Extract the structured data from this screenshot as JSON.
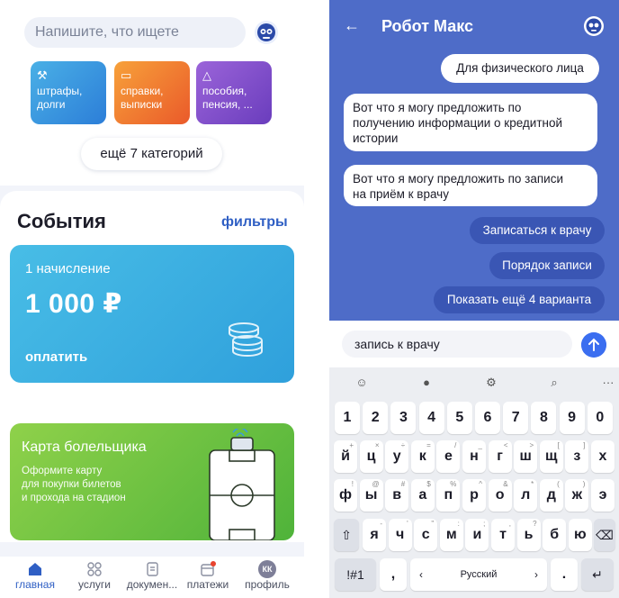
{
  "left": {
    "search_placeholder": "Напишите, что ищете",
    "categories": [
      {
        "label": "штрафы,\nдолги",
        "icon": "hammer-icon"
      },
      {
        "label": "справки,\nвыписки",
        "icon": "folder-icon"
      },
      {
        "label": "пособия,\nпенсия, ...",
        "icon": "piggy-icon"
      }
    ],
    "more_categories": "ещё 7 категорий",
    "events_title": "События",
    "filters_link": "фильтры",
    "payment": {
      "count": "1 начисление",
      "amount": "1 000 ₽",
      "action": "оплатить"
    },
    "fan_card": {
      "title": "Карта болельщика",
      "description": "Оформите карту\nдля покупки билетов\nи прохода на стадион"
    },
    "nav": [
      {
        "label": "главная",
        "active": true
      },
      {
        "label": "услуги"
      },
      {
        "label": "докумен..."
      },
      {
        "label": "платежи"
      },
      {
        "label": "профиль",
        "avatar": "КК"
      }
    ]
  },
  "right": {
    "title": "Робот Макс",
    "messages": [
      {
        "from": "user",
        "text": "Для физического лица"
      },
      {
        "from": "bot",
        "text": "Вот что я могу предложить по\nполучению информации о кредитной\nистории"
      },
      {
        "from": "bot",
        "text": "Вот что я могу предложить по записи\nна приём к врачу"
      }
    ],
    "chips": [
      "Записаться к врачу",
      "Порядок записи",
      "Показать ещё 4 варианта"
    ],
    "input_value": "запись к врачу",
    "keyboard": {
      "numbers": [
        "1",
        "2",
        "3",
        "4",
        "5",
        "6",
        "7",
        "8",
        "9",
        "0"
      ],
      "row1": [
        "й",
        "ц",
        "у",
        "к",
        "е",
        "н",
        "г",
        "ш",
        "щ",
        "з",
        "х"
      ],
      "row1_hints": [
        "+",
        "×",
        "÷",
        "=",
        "/",
        "_",
        "<",
        ">",
        "[",
        "]",
        ""
      ],
      "row2": [
        "ф",
        "ы",
        "в",
        "а",
        "п",
        "р",
        "о",
        "л",
        "д",
        "ж",
        "э"
      ],
      "row2_hints": [
        "!",
        "@",
        "#",
        "$",
        "%",
        "^",
        "&",
        "*",
        "(",
        ")",
        ""
      ],
      "row3": [
        "я",
        "ч",
        "с",
        "м",
        "и",
        "т",
        "ь",
        "б",
        "ю"
      ],
      "row3_hints": [
        "-",
        "'",
        "\"",
        ":",
        ";",
        ",",
        "?",
        "",
        ""
      ],
      "symbols_key": "!#1",
      "comma": ",",
      "space_label": "Русский",
      "period": "."
    }
  },
  "colors": {
    "chat_bg": "#4e6cc8",
    "chip_bg": "#3a56b4",
    "accent": "#2f5fc4",
    "send": "#3b6ef0"
  }
}
